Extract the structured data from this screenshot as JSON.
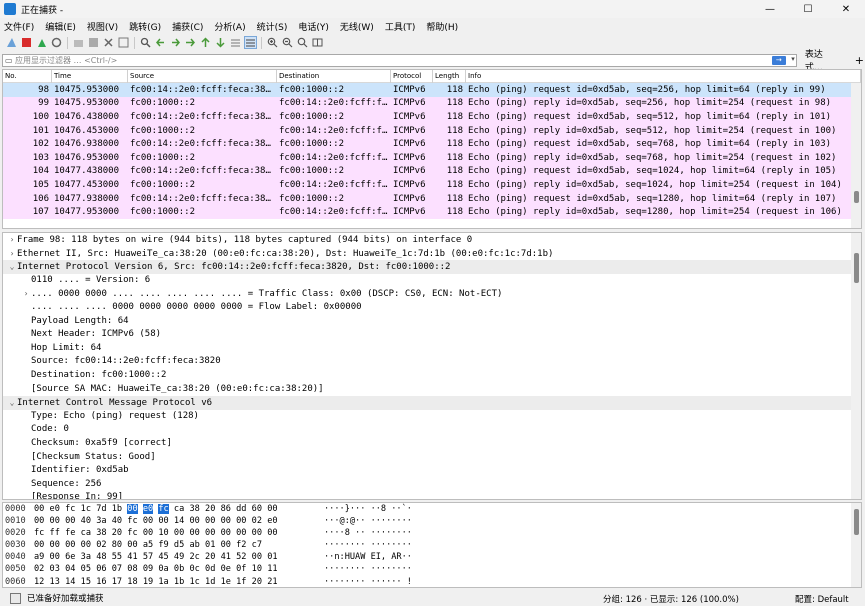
{
  "window": {
    "title": "正在捕获 -",
    "minimize": "—",
    "maximize": "☐",
    "close": "✕"
  },
  "menu": [
    "文件(F)",
    "编辑(E)",
    "视图(V)",
    "跳转(G)",
    "捕获(C)",
    "分析(A)",
    "统计(S)",
    "电话(Y)",
    "无线(W)",
    "工具(T)",
    "帮助(H)"
  ],
  "toolbar": [
    "shark-fin-icon",
    "stop-icon",
    "restart-icon",
    "options-icon",
    "open-icon",
    "save-icon",
    "close-file-icon",
    "reload-icon",
    "find-icon",
    "back-icon",
    "forward-icon",
    "goto-icon",
    "first-icon",
    "last-icon",
    "autoscroll-icon",
    "colorize-icon",
    "zoom-in-icon",
    "zoom-out-icon",
    "zoom-reset-icon",
    "resize-columns-icon"
  ],
  "filter": {
    "placeholder": "应用显示过滤器 … <Ctrl-/>",
    "expression": "表达式…",
    "plus": "+"
  },
  "packet_list": {
    "columns": [
      "No.",
      "Time",
      "Source",
      "Destination",
      "Protocol",
      "Length",
      "Info"
    ],
    "rows": [
      {
        "no": "98",
        "time": "10475.953000",
        "src": "fc00:14::2e0:fcff:feca:38…",
        "dst": "fc00:1000::2",
        "proto": "ICMPv6",
        "len": "118",
        "info": "Echo (ping) request id=0xd5ab, seq=256, hop limit=64 (reply in 99)",
        "selected": true
      },
      {
        "no": "99",
        "time": "10475.953000",
        "src": "fc00:1000::2",
        "dst": "fc00:14::2e0:fcff:f…",
        "proto": "ICMPv6",
        "len": "118",
        "info": "Echo (ping) reply id=0xd5ab, seq=256, hop limit=254 (request in 98)",
        "selected": false
      },
      {
        "no": "100",
        "time": "10476.438000",
        "src": "fc00:14::2e0:fcff:feca:38…",
        "dst": "fc00:1000::2",
        "proto": "ICMPv6",
        "len": "118",
        "info": "Echo (ping) request id=0xd5ab, seq=512, hop limit=64 (reply in 101)",
        "selected": false
      },
      {
        "no": "101",
        "time": "10476.453000",
        "src": "fc00:1000::2",
        "dst": "fc00:14::2e0:fcff:f…",
        "proto": "ICMPv6",
        "len": "118",
        "info": "Echo (ping) reply id=0xd5ab, seq=512, hop limit=254 (request in 100)",
        "selected": false
      },
      {
        "no": "102",
        "time": "10476.938000",
        "src": "fc00:14::2e0:fcff:feca:38…",
        "dst": "fc00:1000::2",
        "proto": "ICMPv6",
        "len": "118",
        "info": "Echo (ping) request id=0xd5ab, seq=768, hop limit=64 (reply in 103)",
        "selected": false
      },
      {
        "no": "103",
        "time": "10476.953000",
        "src": "fc00:1000::2",
        "dst": "fc00:14::2e0:fcff:f…",
        "proto": "ICMPv6",
        "len": "118",
        "info": "Echo (ping) reply id=0xd5ab, seq=768, hop limit=254 (request in 102)",
        "selected": false
      },
      {
        "no": "104",
        "time": "10477.438000",
        "src": "fc00:14::2e0:fcff:feca:38…",
        "dst": "fc00:1000::2",
        "proto": "ICMPv6",
        "len": "118",
        "info": "Echo (ping) request id=0xd5ab, seq=1024, hop limit=64 (reply in 105)",
        "selected": false
      },
      {
        "no": "105",
        "time": "10477.453000",
        "src": "fc00:1000::2",
        "dst": "fc00:14::2e0:fcff:f…",
        "proto": "ICMPv6",
        "len": "118",
        "info": "Echo (ping) reply id=0xd5ab, seq=1024, hop limit=254 (request in 104)",
        "selected": false
      },
      {
        "no": "106",
        "time": "10477.938000",
        "src": "fc00:14::2e0:fcff:feca:38…",
        "dst": "fc00:1000::2",
        "proto": "ICMPv6",
        "len": "118",
        "info": "Echo (ping) request id=0xd5ab, seq=1280, hop limit=64 (reply in 107)",
        "selected": false
      },
      {
        "no": "107",
        "time": "10477.953000",
        "src": "fc00:1000::2",
        "dst": "fc00:14::2e0:fcff:f…",
        "proto": "ICMPv6",
        "len": "118",
        "info": "Echo (ping) reply id=0xd5ab, seq=1280, hop limit=254 (request in 106)",
        "selected": false
      }
    ]
  },
  "details": [
    {
      "arrow": "›",
      "text": "Frame 98: 118 bytes on wire (944 bits), 118 bytes captured (944 bits) on interface 0",
      "indent": 0,
      "section": false
    },
    {
      "arrow": "›",
      "text": "Ethernet II, Src: HuaweiTe_ca:38:20 (00:e0:fc:ca:38:20), Dst: HuaweiTe_1c:7d:1b (00:e0:fc:1c:7d:1b)",
      "indent": 0,
      "section": false
    },
    {
      "arrow": "⌄",
      "text": "Internet Protocol Version 6, Src: fc00:14::2e0:fcff:feca:3820, Dst: fc00:1000::2",
      "indent": 0,
      "section": true
    },
    {
      "arrow": "",
      "text": "0110 .... = Version: 6",
      "indent": 1,
      "section": false
    },
    {
      "arrow": "›",
      "text": ".... 0000 0000 .... .... .... .... .... = Traffic Class: 0x00 (DSCP: CS0, ECN: Not-ECT)",
      "indent": 1,
      "section": false
    },
    {
      "arrow": "",
      "text": ".... .... .... 0000 0000 0000 0000 0000 = Flow Label: 0x00000",
      "indent": 1,
      "section": false
    },
    {
      "arrow": "",
      "text": "Payload Length: 64",
      "indent": 1,
      "section": false
    },
    {
      "arrow": "",
      "text": "Next Header: ICMPv6 (58)",
      "indent": 1,
      "section": false
    },
    {
      "arrow": "",
      "text": "Hop Limit: 64",
      "indent": 1,
      "section": false
    },
    {
      "arrow": "",
      "text": "Source: fc00:14::2e0:fcff:feca:3820",
      "indent": 1,
      "section": false
    },
    {
      "arrow": "",
      "text": "Destination: fc00:1000::2",
      "indent": 1,
      "section": false
    },
    {
      "arrow": "",
      "text": "[Source SA MAC: HuaweiTe_ca:38:20 (00:e0:fc:ca:38:20)]",
      "indent": 1,
      "section": false
    },
    {
      "arrow": "⌄",
      "text": "Internet Control Message Protocol v6",
      "indent": 0,
      "section": true
    },
    {
      "arrow": "",
      "text": "Type: Echo (ping) request (128)",
      "indent": 1,
      "section": false
    },
    {
      "arrow": "",
      "text": "Code: 0",
      "indent": 1,
      "section": false
    },
    {
      "arrow": "",
      "text": "Checksum: 0xa5f9 [correct]",
      "indent": 1,
      "section": false
    },
    {
      "arrow": "",
      "text": "[Checksum Status: Good]",
      "indent": 1,
      "section": false
    },
    {
      "arrow": "",
      "text": "Identifier: 0xd5ab",
      "indent": 1,
      "section": false
    },
    {
      "arrow": "",
      "text": "Sequence: 256",
      "indent": 1,
      "section": false
    },
    {
      "arrow": "",
      "text": "[Response In: 99]",
      "indent": 1,
      "section": false
    }
  ],
  "hex": [
    {
      "off": "0000",
      "bytes": [
        "00",
        "e0",
        "fc",
        "1c",
        "7d",
        "1b",
        "00",
        "e0",
        "fc",
        "ca",
        "38",
        "20",
        "86",
        "dd",
        "60",
        "00"
      ],
      "ascii": "····}··· ··8 ··`·",
      "hl": [
        6,
        7,
        8
      ]
    },
    {
      "off": "0010",
      "bytes": [
        "00",
        "00",
        "00",
        "40",
        "3a",
        "40",
        "fc",
        "00",
        "00",
        "14",
        "00",
        "00",
        "00",
        "00",
        "02",
        "e0"
      ],
      "ascii": "···@:@·· ········",
      "hl": []
    },
    {
      "off": "0020",
      "bytes": [
        "fc",
        "ff",
        "fe",
        "ca",
        "38",
        "20",
        "fc",
        "00",
        "10",
        "00",
        "00",
        "00",
        "00",
        "00",
        "00",
        "00"
      ],
      "ascii": "····8 ·· ········",
      "hl": []
    },
    {
      "off": "0030",
      "bytes": [
        "00",
        "00",
        "00",
        "00",
        "02",
        "80",
        "00",
        "a5",
        "f9",
        "d5",
        "ab",
        "01",
        "00",
        "f2",
        "c7"
      ],
      "ascii": "········ ········",
      "hl": []
    },
    {
      "off": "0040",
      "bytes": [
        "a9",
        "00",
        "6e",
        "3a",
        "48",
        "55",
        "41",
        "57",
        "45",
        "49",
        "2c",
        "20",
        "41",
        "52",
        "00",
        "01"
      ],
      "ascii": "··n:HUAW EI, AR··",
      "hl": []
    },
    {
      "off": "0050",
      "bytes": [
        "02",
        "03",
        "04",
        "05",
        "06",
        "07",
        "08",
        "09",
        "0a",
        "0b",
        "0c",
        "0d",
        "0e",
        "0f",
        "10",
        "11"
      ],
      "ascii": "········ ········",
      "hl": []
    },
    {
      "off": "0060",
      "bytes": [
        "12",
        "13",
        "14",
        "15",
        "16",
        "17",
        "18",
        "19",
        "1a",
        "1b",
        "1c",
        "1d",
        "1e",
        "1f",
        "20",
        "21"
      ],
      "ascii": "········ ······ !",
      "hl": []
    }
  ],
  "status": {
    "text": "已准备好加载或捕获",
    "counts": "分组: 126 · 已显示: 126 (100.0%)",
    "profile": "配置: Default"
  }
}
